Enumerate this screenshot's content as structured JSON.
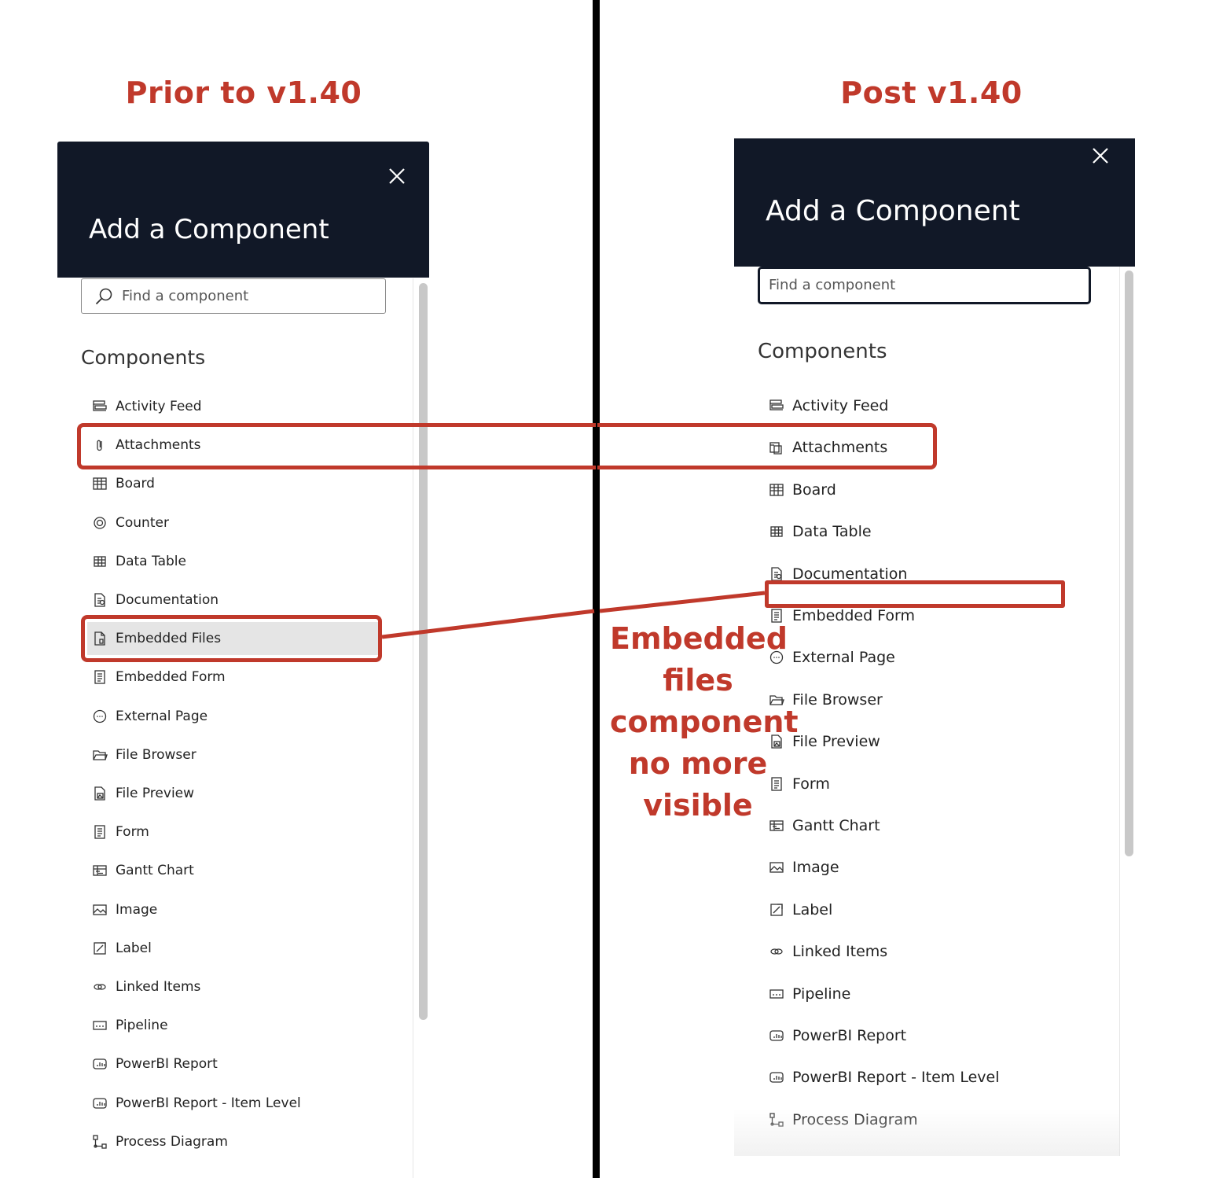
{
  "captions": {
    "left": "Prior to v1.40",
    "right": "Post v1.40",
    "note_lines": [
      "Embedded",
      "files",
      "component",
      "no more",
      "visible"
    ]
  },
  "colors": {
    "header_bg": "#111827",
    "annotation": "#c0392b",
    "selected_bg": "#e5e5e5"
  },
  "left_panel": {
    "title": "Add a Component",
    "search_placeholder": "Find a component",
    "section_heading": "Components",
    "items": [
      {
        "label": "Activity Feed",
        "icon": "activity-feed-icon"
      },
      {
        "label": "Attachments",
        "icon": "paperclip-icon"
      },
      {
        "label": "Board",
        "icon": "board-icon"
      },
      {
        "label": "Counter",
        "icon": "counter-icon"
      },
      {
        "label": "Data Table",
        "icon": "table-icon"
      },
      {
        "label": "Documentation",
        "icon": "documentation-icon"
      },
      {
        "label": "Embedded Files",
        "icon": "embedded-files-icon",
        "selected": true
      },
      {
        "label": "Embedded Form",
        "icon": "form-icon"
      },
      {
        "label": "External Page",
        "icon": "external-page-icon"
      },
      {
        "label": "File Browser",
        "icon": "folder-icon"
      },
      {
        "label": "File Preview",
        "icon": "file-preview-icon"
      },
      {
        "label": "Form",
        "icon": "form-icon"
      },
      {
        "label": "Gantt Chart",
        "icon": "gantt-icon"
      },
      {
        "label": "Image",
        "icon": "image-icon"
      },
      {
        "label": "Label",
        "icon": "label-icon"
      },
      {
        "label": "Linked Items",
        "icon": "link-icon"
      },
      {
        "label": "Pipeline",
        "icon": "pipeline-icon"
      },
      {
        "label": "PowerBI Report",
        "icon": "powerbi-icon"
      },
      {
        "label": "PowerBI Report - Item Level",
        "icon": "powerbi-icon"
      },
      {
        "label": "Process Diagram",
        "icon": "process-diagram-icon"
      }
    ]
  },
  "right_panel": {
    "title": "Add a Component",
    "search_placeholder": "Find a component",
    "section_heading": "Components",
    "items": [
      {
        "label": "Activity Feed",
        "icon": "activity-feed-icon"
      },
      {
        "label": "Attachments",
        "icon": "attachments-icon"
      },
      {
        "label": "Board",
        "icon": "board-icon"
      },
      {
        "label": "Data Table",
        "icon": "table-icon"
      },
      {
        "label": "Documentation",
        "icon": "documentation-icon"
      },
      {
        "label": "Embedded Form",
        "icon": "form-icon"
      },
      {
        "label": "External Page",
        "icon": "external-page-icon"
      },
      {
        "label": "File Browser",
        "icon": "folder-icon"
      },
      {
        "label": "File Preview",
        "icon": "file-preview-icon"
      },
      {
        "label": "Form",
        "icon": "form-icon"
      },
      {
        "label": "Gantt Chart",
        "icon": "gantt-icon"
      },
      {
        "label": "Image",
        "icon": "image-icon"
      },
      {
        "label": "Label",
        "icon": "label-icon"
      },
      {
        "label": "Linked Items",
        "icon": "link-icon"
      },
      {
        "label": "Pipeline",
        "icon": "pipeline-icon"
      },
      {
        "label": "PowerBI Report",
        "icon": "powerbi-icon"
      },
      {
        "label": "PowerBI Report - Item Level",
        "icon": "powerbi-icon"
      },
      {
        "label": "Process Diagram",
        "icon": "process-diagram-icon"
      }
    ]
  }
}
